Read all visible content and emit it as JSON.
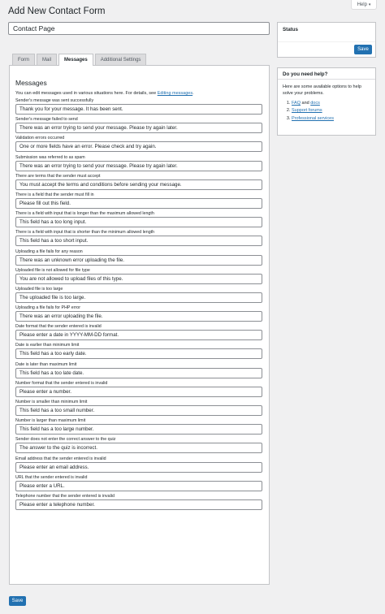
{
  "help": {
    "label": "Help",
    "caret": "▾"
  },
  "page": {
    "title": "Add New Contact Form"
  },
  "form": {
    "title_value": "Contact Page"
  },
  "tabs": [
    {
      "label": "Form"
    },
    {
      "label": "Mail"
    },
    {
      "label": "Messages"
    },
    {
      "label": "Additional Settings"
    }
  ],
  "messages": {
    "heading": "Messages",
    "description_prefix": "You can edit messages used in various situations here. For details, see ",
    "description_link": "Editing messages",
    "description_suffix": ".",
    "items": [
      {
        "label": "Sender's message was sent successfully",
        "value": "Thank you for your message. It has been sent."
      },
      {
        "label": "Sender's message failed to send",
        "value": "There was an error trying to send your message. Please try again later."
      },
      {
        "label": "Validation errors occurred",
        "value": "One or more fields have an error. Please check and try again."
      },
      {
        "label": "Submission was referred to as spam",
        "value": "There was an error trying to send your message. Please try again later."
      },
      {
        "label": "There are terms that the sender must accept",
        "value": "You must accept the terms and conditions before sending your message."
      },
      {
        "label": "There is a field that the sender must fill in",
        "value": "Please fill out this field."
      },
      {
        "label": "There is a field with input that is longer than the maximum allowed length",
        "value": "This field has a too long input."
      },
      {
        "label": "There is a field with input that is shorter than the minimum allowed length",
        "value": "This field has a too short input."
      },
      {
        "label": "Uploading a file fails for any reason",
        "value": "There was an unknown error uploading the file."
      },
      {
        "label": "Uploaded file is not allowed for file type",
        "value": "You are not allowed to upload files of this type."
      },
      {
        "label": "Uploaded file is too large",
        "value": "The uploaded file is too large."
      },
      {
        "label": "Uploading a file fails for PHP error",
        "value": "There was an error uploading the file."
      },
      {
        "label": "Date format that the sender entered is invalid",
        "value": "Please enter a date in YYYY-MM-DD format."
      },
      {
        "label": "Date is earlier than minimum limit",
        "value": "This field has a too early date."
      },
      {
        "label": "Date is later than maximum limit",
        "value": "This field has a too late date."
      },
      {
        "label": "Number format that the sender entered is invalid",
        "value": "Please enter a number."
      },
      {
        "label": "Number is smaller than minimum limit",
        "value": "This field has a too small number."
      },
      {
        "label": "Number is larger than maximum limit",
        "value": "This field has a too large number."
      },
      {
        "label": "Sender does not enter the correct answer to the quiz",
        "value": "The answer to the quiz is incorrect."
      },
      {
        "label": "Email address that the sender entered is invalid",
        "value": "Please enter an email address."
      },
      {
        "label": "URL that the sender entered is invalid",
        "value": "Please enter a URL."
      },
      {
        "label": "Telephone number that the sender entered is invalid",
        "value": "Please enter a telephone number."
      }
    ]
  },
  "save_bottom": "Save",
  "status_box": {
    "title": "Status",
    "save_label": "Save"
  },
  "help_box": {
    "title": "Do you need help?",
    "intro": "Here are some available options to help solve your problems.",
    "items": [
      {
        "prefix": "",
        "link1": "FAQ",
        "middle": " and ",
        "link2": "docs"
      },
      {
        "prefix": "",
        "link1": "Support forums"
      },
      {
        "prefix": "",
        "link1": "Professional services"
      }
    ]
  }
}
